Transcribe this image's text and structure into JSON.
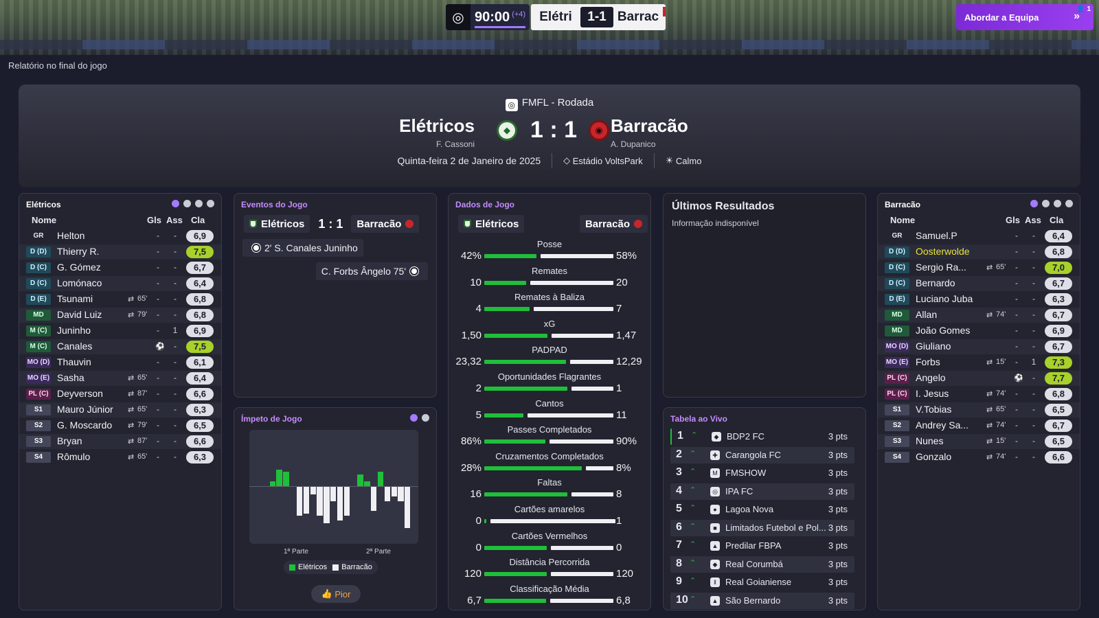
{
  "topbar": {
    "clock": "90:00",
    "added_time": "(+4)",
    "home_short": "Elétri",
    "score": "1-1",
    "away_short": "Barrac",
    "team_button": "Abordar a Equipa",
    "notif_count": "1",
    "icons": [
      "ball-clock-icon",
      "double-chevron-right-icon",
      "person-icon"
    ]
  },
  "page_label": "Relatório no final do jogo",
  "header": {
    "competition": "FMFL - Rodada",
    "home_team": "Elétricos",
    "home_manager": "F. Cassoni",
    "away_team": "Barracão",
    "away_manager": "A. Dupanico",
    "score": "1 : 1",
    "date": "Quinta-feira 2 de Janeiro de 2025",
    "stadium": "Estádio VoltsPark",
    "weather": "Calmo"
  },
  "home_lineup": {
    "title": "Elétricos",
    "col_name": "Nome",
    "col_gls": "Gls",
    "col_ass": "Ass",
    "col_cla": "Cla",
    "players": [
      {
        "pos": "GR",
        "cls": "gk",
        "name": "Helton",
        "sub": "",
        "gls": "-",
        "ass": "-",
        "rating": "6,9",
        "good": false,
        "hl": false
      },
      {
        "pos": "D (D)",
        "cls": "def",
        "name": "Thierry R.",
        "sub": "",
        "gls": "-",
        "ass": "-",
        "rating": "7,5",
        "good": true,
        "hl": false
      },
      {
        "pos": "D (C)",
        "cls": "def",
        "name": "G. Gómez",
        "sub": "",
        "gls": "-",
        "ass": "-",
        "rating": "6,7",
        "good": false,
        "hl": false
      },
      {
        "pos": "D (C)",
        "cls": "def",
        "name": "Lomónaco",
        "sub": "",
        "gls": "-",
        "ass": "-",
        "rating": "6,4",
        "good": false,
        "hl": false
      },
      {
        "pos": "D (E)",
        "cls": "def",
        "name": "Tsunami",
        "sub": "65'",
        "gls": "-",
        "ass": "-",
        "rating": "6,8",
        "good": false,
        "hl": false
      },
      {
        "pos": "MD",
        "cls": "mid",
        "name": "David Luiz",
        "sub": "79'",
        "gls": "-",
        "ass": "-",
        "rating": "6,8",
        "good": false,
        "hl": false
      },
      {
        "pos": "M (C)",
        "cls": "mid",
        "name": "Juninho",
        "sub": "",
        "gls": "-",
        "ass": "1",
        "rating": "6,9",
        "good": false,
        "hl": false
      },
      {
        "pos": "M (C)",
        "cls": "mid",
        "name": "Canales",
        "sub": "goal",
        "gls": "-",
        "ass": "-",
        "rating": "7,5",
        "good": true,
        "hl": false
      },
      {
        "pos": "MO (D)",
        "cls": "am",
        "name": "Thauvin",
        "sub": "",
        "gls": "-",
        "ass": "-",
        "rating": "6,1",
        "good": false,
        "hl": false
      },
      {
        "pos": "MO (E)",
        "cls": "am",
        "name": "Sasha",
        "sub": "65'",
        "gls": "-",
        "ass": "-",
        "rating": "6,4",
        "good": false,
        "hl": false
      },
      {
        "pos": "PL (C)",
        "cls": "fw",
        "name": "Deyverson",
        "sub": "87'",
        "gls": "-",
        "ass": "-",
        "rating": "6,6",
        "good": false,
        "hl": false
      },
      {
        "pos": "S1",
        "cls": "sub",
        "name": "Mauro Júnior",
        "sub": "65'",
        "gls": "-",
        "ass": "-",
        "rating": "6,3",
        "good": false,
        "hl": false
      },
      {
        "pos": "S2",
        "cls": "sub",
        "name": "G. Moscardo",
        "sub": "79'",
        "gls": "-",
        "ass": "-",
        "rating": "6,5",
        "good": false,
        "hl": false
      },
      {
        "pos": "S3",
        "cls": "sub",
        "name": "Bryan",
        "sub": "87'",
        "gls": "-",
        "ass": "-",
        "rating": "6,6",
        "good": false,
        "hl": false
      },
      {
        "pos": "S4",
        "cls": "sub",
        "name": "Rômulo",
        "sub": "65'",
        "gls": "-",
        "ass": "-",
        "rating": "6,3",
        "good": false,
        "hl": false
      }
    ]
  },
  "away_lineup": {
    "title": "Barracão",
    "col_name": "Nome",
    "col_gls": "Gls",
    "col_ass": "Ass",
    "col_cla": "Cla",
    "players": [
      {
        "pos": "GR",
        "cls": "gk",
        "name": "Samuel.P",
        "sub": "",
        "gls": "-",
        "ass": "-",
        "rating": "6,4",
        "good": false,
        "hl": false
      },
      {
        "pos": "D (D)",
        "cls": "def",
        "name": "Oosterwolde",
        "sub": "",
        "gls": "-",
        "ass": "-",
        "rating": "6,8",
        "good": false,
        "hl": true
      },
      {
        "pos": "D (C)",
        "cls": "def",
        "name": "Sergio Ra...",
        "sub": "65'",
        "gls": "-",
        "ass": "-",
        "rating": "7,0",
        "good": true,
        "hl": false
      },
      {
        "pos": "D (C)",
        "cls": "def",
        "name": "Bernardo",
        "sub": "",
        "gls": "-",
        "ass": "-",
        "rating": "6,7",
        "good": false,
        "hl": false
      },
      {
        "pos": "D (E)",
        "cls": "def",
        "name": "Luciano Juba",
        "sub": "",
        "gls": "-",
        "ass": "-",
        "rating": "6,3",
        "good": false,
        "hl": false
      },
      {
        "pos": "MD",
        "cls": "mid",
        "name": "Allan",
        "sub": "74'",
        "gls": "-",
        "ass": "-",
        "rating": "6,7",
        "good": false,
        "hl": false
      },
      {
        "pos": "MD",
        "cls": "mid",
        "name": "João Gomes",
        "sub": "",
        "gls": "-",
        "ass": "-",
        "rating": "6,9",
        "good": false,
        "hl": false
      },
      {
        "pos": "MO (D)",
        "cls": "am",
        "name": "Giuliano",
        "sub": "",
        "gls": "-",
        "ass": "-",
        "rating": "6,7",
        "good": false,
        "hl": false
      },
      {
        "pos": "MO (E)",
        "cls": "am",
        "name": "Forbs",
        "sub": "15'",
        "gls": "-",
        "ass": "1",
        "rating": "7,3",
        "good": true,
        "hl": false
      },
      {
        "pos": "PL (C)",
        "cls": "fw",
        "name": "Angelo",
        "sub": "goal",
        "gls": "-",
        "ass": "-",
        "rating": "7,7",
        "good": true,
        "hl": false
      },
      {
        "pos": "PL (C)",
        "cls": "fw",
        "name": "I. Jesus",
        "sub": "74'",
        "gls": "-",
        "ass": "-",
        "rating": "6,8",
        "good": false,
        "hl": false
      },
      {
        "pos": "S1",
        "cls": "sub",
        "name": "V.Tobias",
        "sub": "65'",
        "gls": "-",
        "ass": "-",
        "rating": "6,5",
        "good": false,
        "hl": false
      },
      {
        "pos": "S2",
        "cls": "sub",
        "name": "Andrey Sa...",
        "sub": "74'",
        "gls": "-",
        "ass": "-",
        "rating": "6,7",
        "good": false,
        "hl": false
      },
      {
        "pos": "S3",
        "cls": "sub",
        "name": "Nunes",
        "sub": "15'",
        "gls": "-",
        "ass": "-",
        "rating": "6,5",
        "good": false,
        "hl": false
      },
      {
        "pos": "S4",
        "cls": "sub",
        "name": "Gonzalo",
        "sub": "74'",
        "gls": "-",
        "ass": "-",
        "rating": "6,6",
        "good": false,
        "hl": false
      }
    ]
  },
  "events": {
    "title": "Eventos do Jogo",
    "home": "Elétricos",
    "score": "1 : 1",
    "away": "Barracão",
    "items": [
      {
        "text": "2' S. Canales Juninho",
        "side": "home"
      },
      {
        "text": "C. Forbs Ângelo 75'",
        "side": "away"
      }
    ]
  },
  "momentum": {
    "title": "Ímpeto de Jogo",
    "first_half": "1ª Parte",
    "second_half": "2ª Parte",
    "home_label": "Elétricos",
    "away_label": "Barracão",
    "button": "Pior",
    "colors": {
      "home": "#1fbf3a",
      "away": "#f0f0f4"
    },
    "bars": [
      0,
      0,
      0.1,
      0.35,
      0.3,
      0,
      -0.6,
      -0.55,
      -0.15,
      -0.6,
      -0.75,
      -0.3,
      -0.7,
      -0.6,
      0,
      0.25,
      0.1,
      -0.5,
      0.3,
      -0.3,
      -0.2,
      -0.3,
      -0.85
    ]
  },
  "stats": {
    "title": "Dados de Jogo",
    "home": "Elétricos",
    "away": "Barracão",
    "rows": [
      {
        "label": "Posse",
        "h": "42%",
        "a": "58%",
        "hv": 42,
        "av": 58
      },
      {
        "label": "Remates",
        "h": "10",
        "a": "20",
        "hv": 10,
        "av": 20
      },
      {
        "label": "Remates à Baliza",
        "h": "4",
        "a": "7",
        "hv": 4,
        "av": 7
      },
      {
        "label": "xG",
        "h": "1,50",
        "a": "1,47",
        "hv": 1.5,
        "av": 1.47
      },
      {
        "label": "PADPAD",
        "h": "23,32",
        "a": "12,29",
        "hv": 23.32,
        "av": 12.29
      },
      {
        "label": "Oportunidades Flagrantes",
        "h": "2",
        "a": "1",
        "hv": 2,
        "av": 1
      },
      {
        "label": "Cantos",
        "h": "5",
        "a": "11",
        "hv": 5,
        "av": 11
      },
      {
        "label": "Passes Completados",
        "h": "86%",
        "a": "90%",
        "hv": 86,
        "av": 90
      },
      {
        "label": "Cruzamentos Completados",
        "h": "28%",
        "a": "8%",
        "hv": 28,
        "av": 8
      },
      {
        "label": "Faltas",
        "h": "16",
        "a": "8",
        "hv": 16,
        "av": 8
      },
      {
        "label": "Cartões amarelos",
        "h": "0",
        "a": "1",
        "hv": 0,
        "av": 1
      },
      {
        "label": "Cartões Vermelhos",
        "h": "0",
        "a": "0",
        "hv": 0,
        "av": 0
      },
      {
        "label": "Distância Percorrida",
        "h": "120",
        "a": "120",
        "hv": 120,
        "av": 120
      },
      {
        "label": "Classificação Média",
        "h": "6,7",
        "a": "6,8",
        "hv": 6.7,
        "av": 6.8
      }
    ]
  },
  "results": {
    "title": "Últimos Resultados",
    "subtitle": "Informação indisponível"
  },
  "table": {
    "title": "Tabela ao Vivo",
    "rows": [
      {
        "pos": "1",
        "name": "BDP2 FC",
        "pts": "3 pts",
        "me": true
      },
      {
        "pos": "2",
        "name": "Carangola FC",
        "pts": "3 pts",
        "me": false
      },
      {
        "pos": "3",
        "name": "FMSHOW",
        "pts": "3 pts",
        "me": false
      },
      {
        "pos": "4",
        "name": "IPA FC",
        "pts": "3 pts",
        "me": false
      },
      {
        "pos": "5",
        "name": "Lagoa Nova",
        "pts": "3 pts",
        "me": false
      },
      {
        "pos": "6",
        "name": "Limitados Futebol e Pol...",
        "pts": "3 pts",
        "me": false
      },
      {
        "pos": "7",
        "name": "Predilar FBPA",
        "pts": "3 pts",
        "me": false
      },
      {
        "pos": "8",
        "name": "Real Corumbá",
        "pts": "3 pts",
        "me": false
      },
      {
        "pos": "9",
        "name": "Real Goianiense",
        "pts": "3 pts",
        "me": false
      },
      {
        "pos": "10",
        "name": "São Bernardo",
        "pts": "3 pts",
        "me": false
      }
    ]
  }
}
